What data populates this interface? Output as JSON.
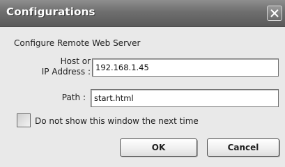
{
  "window": {
    "title": "Configurations",
    "close_icon": "close-icon"
  },
  "form": {
    "heading": "Configure Remote Web Server",
    "host_label_line1": "Host or",
    "host_label_line2": "IP Address :",
    "host_value": "192.168.1.45",
    "path_label": "Path :",
    "path_value": "start.html",
    "checkbox_label": "Do not show this window the next time",
    "checkbox_checked": false
  },
  "buttons": {
    "ok_label": "OK",
    "cancel_label": "Cancel"
  }
}
